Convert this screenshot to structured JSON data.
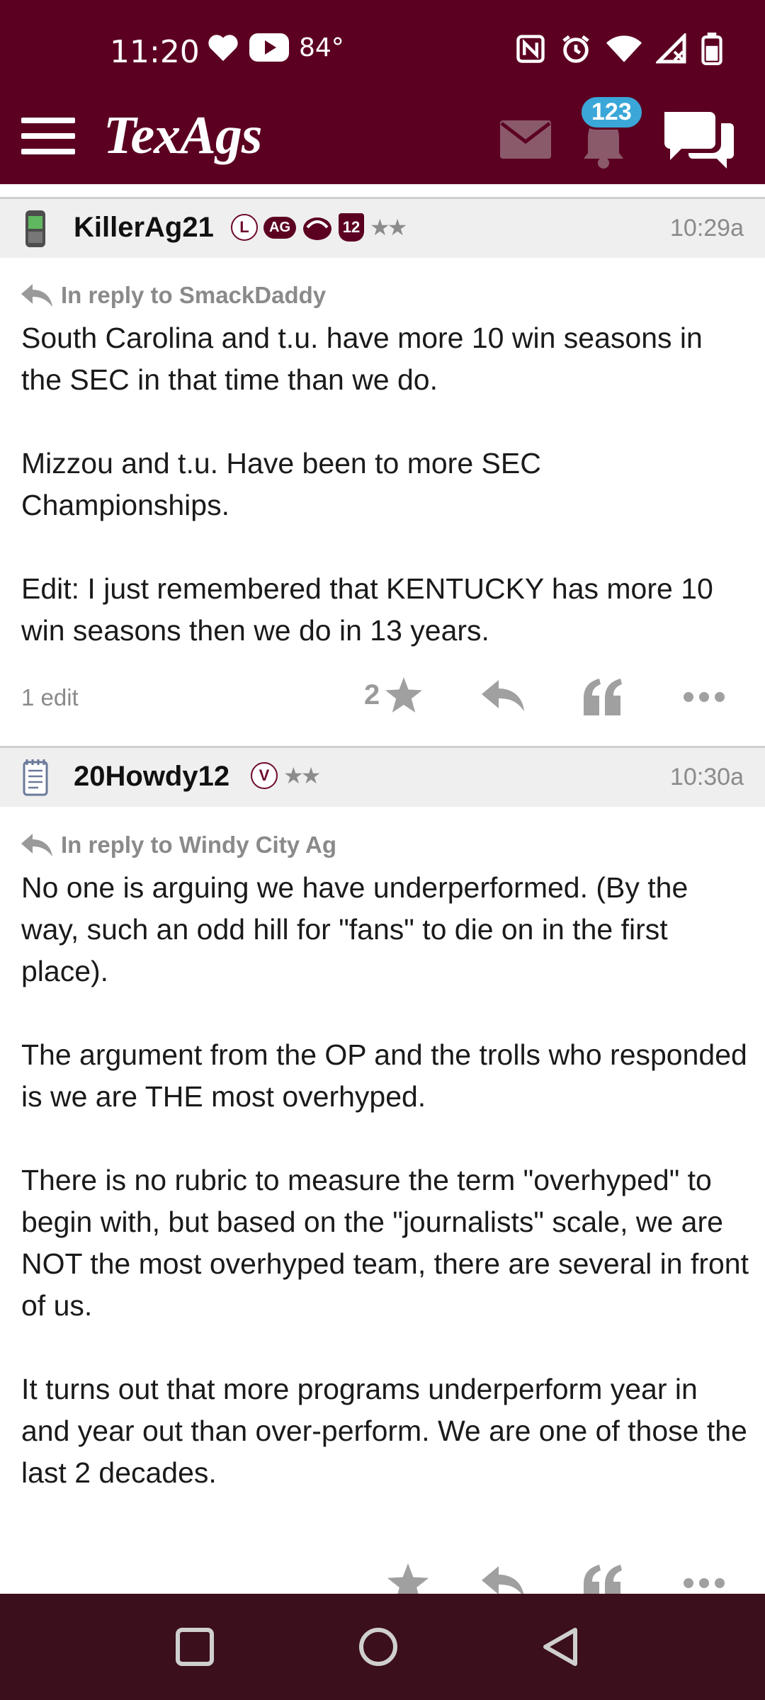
{
  "status_bar": {
    "time": "11:20",
    "temperature": "84°"
  },
  "app": {
    "logo": "TexAgs",
    "notification_count": "123"
  },
  "posts": [
    {
      "username": "KillerAg21",
      "badges": [
        "L",
        "AG",
        "12"
      ],
      "time": "10:29a",
      "reply_to": "In reply to SmackDaddy",
      "body": "South Carolina and t.u. have more 10 win seasons in the SEC in that time than we do.\n\nMizzou and t.u. Have been to more SEC Championships.\n\nEdit: I just remembered that KENTUCKY has more 10 win seasons then we do in 13 years.",
      "edit_note": "1 edit",
      "star_count": "2"
    },
    {
      "username": "20Howdy12",
      "badges": [
        "V"
      ],
      "time": "10:30a",
      "reply_to": "In reply to Windy City Ag",
      "body": "No one is arguing we have underperformed. (By the way, such an odd hill for \"fans\" to die on in the first place).\n\nThe argument from the OP and the trolls who responded is we are THE most overhyped.\n\nThere is no rubric to measure the term \"overhyped\" to begin with, but based on the \"journalists\" scale, we are NOT the most overhyped team, there are several in front of us.\n\nIt turns out that more programs underperform year in and year out than over-perform. We are one of those the last 2 decades."
    }
  ],
  "colors": {
    "brand_maroon": "#5c0022",
    "badge_blue": "#3aa7d8",
    "nav_bar": "#3b0f1b",
    "muted_gray": "#8a8a8a"
  },
  "icons": [
    "menu-icon",
    "mail-icon",
    "bell-icon",
    "chat-icon",
    "star-icon",
    "reply-icon",
    "quote-icon",
    "more-icon",
    "square-nav-icon",
    "circle-nav-icon",
    "back-nav-icon"
  ]
}
